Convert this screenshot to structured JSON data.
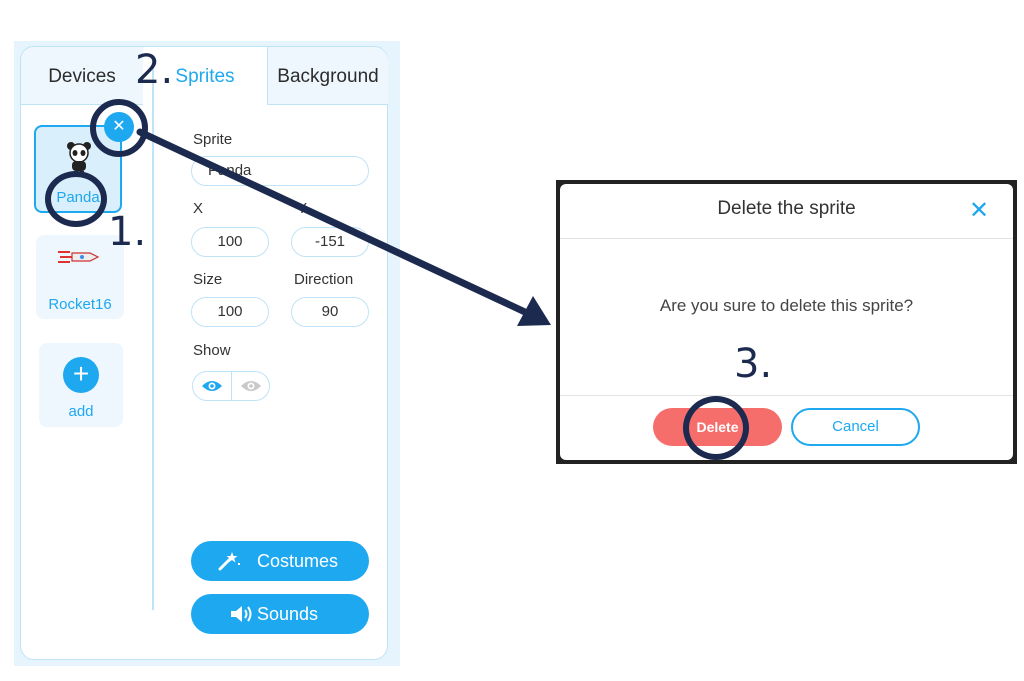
{
  "tabs": [
    {
      "label": "Devices"
    },
    {
      "label": "Sprites"
    },
    {
      "label": "Background"
    }
  ],
  "sprites": [
    {
      "name": "Panda",
      "icon": "panda-icon"
    },
    {
      "name": "Rocket16",
      "icon": "rocket-icon"
    }
  ],
  "add_label": "add",
  "properties": {
    "sprite_label": "Sprite",
    "sprite_value": "Panda",
    "x_label": "X",
    "x_value": "100",
    "y_label": "Y",
    "y_value": "-151",
    "size_label": "Size",
    "size_value": "100",
    "direction_label": "Direction",
    "direction_value": "90",
    "show_label": "Show"
  },
  "buttons": {
    "costumes": "Costumes",
    "sounds": "Sounds"
  },
  "dialog": {
    "title": "Delete the sprite",
    "message": "Are you sure to delete this sprite?",
    "delete": "Delete",
    "cancel": "Cancel"
  },
  "steps": {
    "one": "1.",
    "two": "2.",
    "three": "3."
  },
  "colors": {
    "accent": "#1ea8f0",
    "delete": "#f66e6b",
    "annotation": "#1b2a4e"
  }
}
